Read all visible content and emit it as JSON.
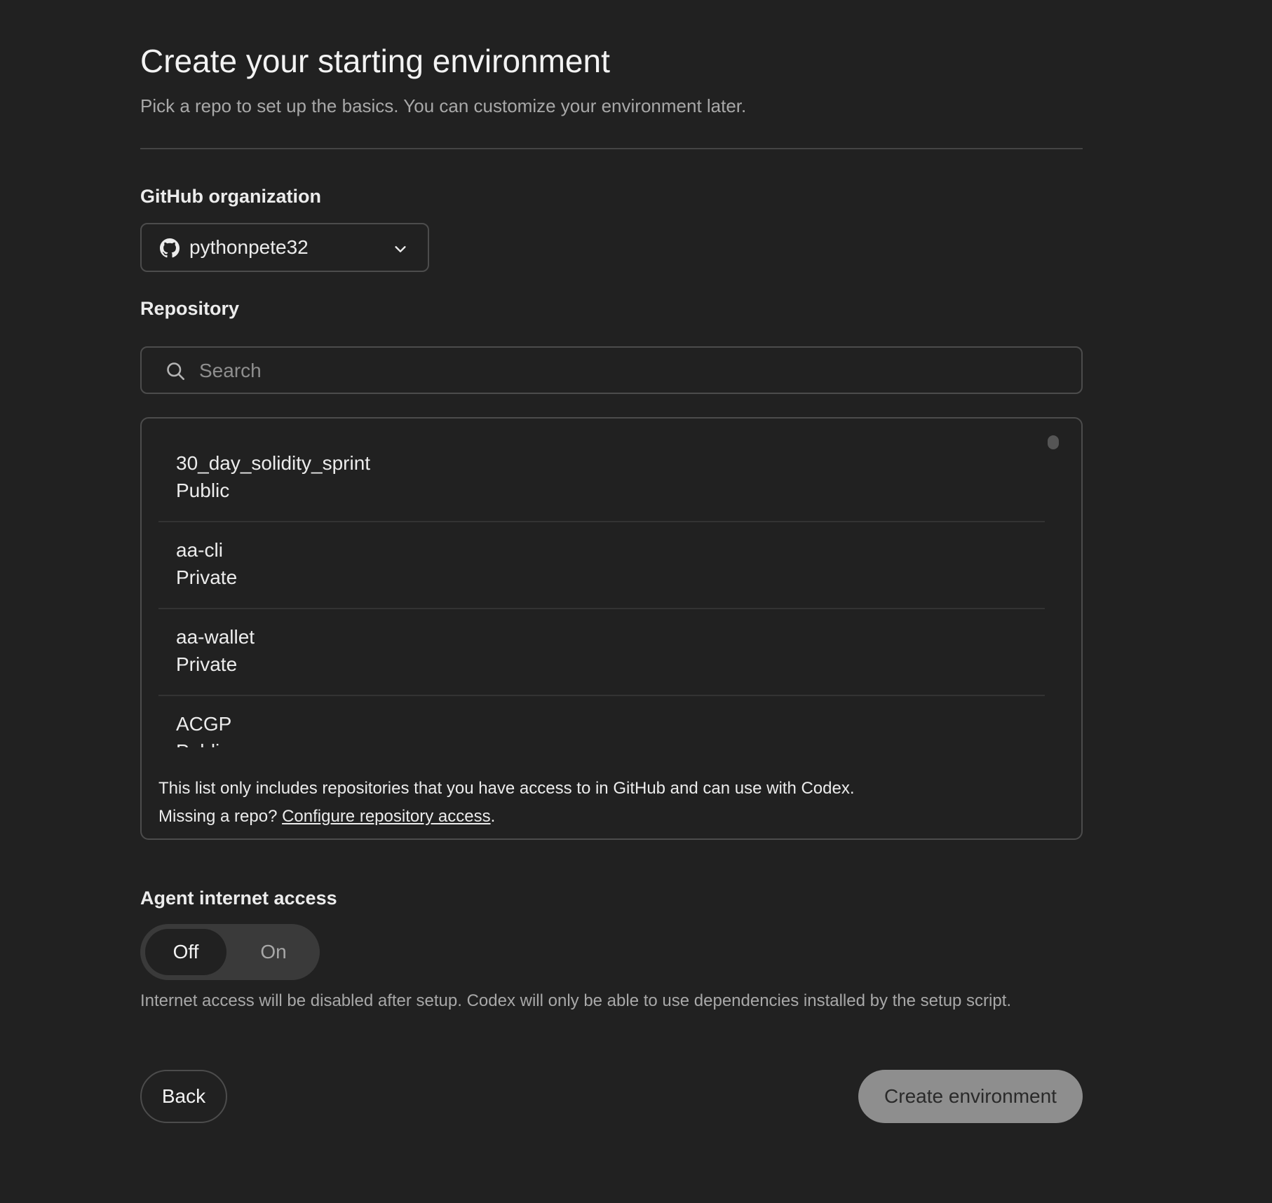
{
  "header": {
    "title": "Create your starting environment",
    "subtitle": "Pick a repo to set up the basics. You can customize your environment later."
  },
  "github_org": {
    "label": "GitHub organization",
    "selected": "pythonpete32",
    "icon": "github-icon"
  },
  "repository": {
    "label": "Repository",
    "search_placeholder": "Search",
    "items": [
      {
        "name": "30_day_solidity_sprint",
        "visibility": "Public"
      },
      {
        "name": "aa-cli",
        "visibility": "Private"
      },
      {
        "name": "aa-wallet",
        "visibility": "Private"
      },
      {
        "name": "ACGP",
        "visibility": "Public"
      }
    ],
    "note_line1": "This list only includes repositories that you have access to in GitHub and can use with Codex.",
    "note_prefix": "Missing a repo? ",
    "note_link": "Configure repository access",
    "note_suffix": "."
  },
  "internet_access": {
    "label": "Agent internet access",
    "off_label": "Off",
    "on_label": "On",
    "selected": "Off",
    "help": "Internet access will be disabled after setup. Codex will only be able to use dependencies installed by the setup script."
  },
  "footer": {
    "back_label": "Back",
    "create_label": "Create environment"
  },
  "colors": {
    "background": "#212121",
    "border": "#4c4c4c",
    "primary_button": "#8e8e8e"
  }
}
